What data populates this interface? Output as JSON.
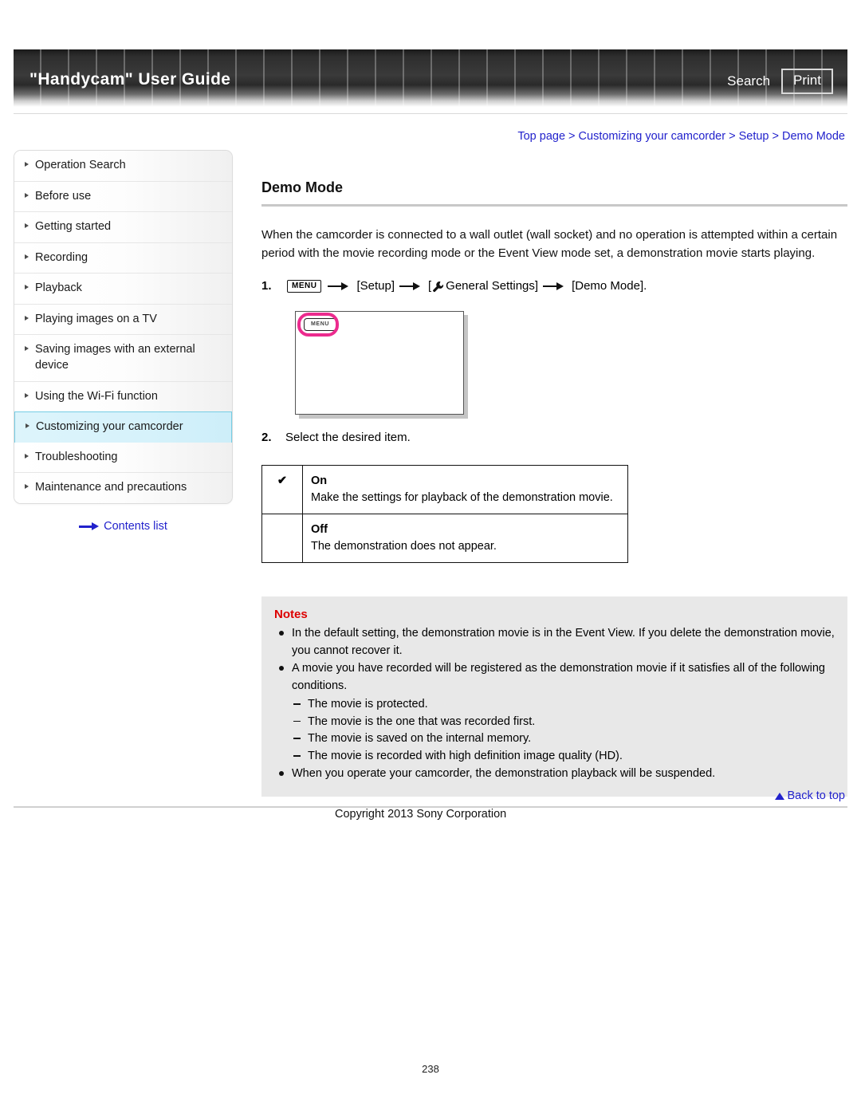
{
  "header": {
    "title": "\"Handycam\" User Guide",
    "search_label": "Search",
    "print_label": "Print"
  },
  "breadcrumb": {
    "text": "Top page > Customizing your camcorder > Setup > Demo Mode"
  },
  "sidebar": {
    "items": [
      {
        "label": "Operation Search",
        "active": false
      },
      {
        "label": "Before use",
        "active": false
      },
      {
        "label": "Getting started",
        "active": false
      },
      {
        "label": "Recording",
        "active": false
      },
      {
        "label": "Playback",
        "active": false
      },
      {
        "label": "Playing images on a TV",
        "active": false
      },
      {
        "label": "Saving images with an external device",
        "active": false
      },
      {
        "label": "Using the Wi-Fi function",
        "active": false
      },
      {
        "label": "Customizing your camcorder",
        "active": true
      },
      {
        "label": "Troubleshooting",
        "active": false
      },
      {
        "label": "Maintenance and precautions",
        "active": false
      }
    ],
    "contents_link": "Contents list",
    "active_bg": "#d6f2fb",
    "active_border": "#76cde4"
  },
  "main": {
    "title": "Demo Mode",
    "intro": "When the camcorder is connected to a wall outlet (wall socket) and no operation is attempted within a certain period with the movie recording mode or the Event View mode set, a demonstration movie starts playing.",
    "step1": {
      "number": "1.",
      "menu_chip": "MENU",
      "part1": "[Setup]",
      "part2": "General Settings]",
      "part2_prefix": "[",
      "part3": "[Demo Mode]."
    },
    "step2": {
      "number": "2.",
      "text": "Select the desired item."
    },
    "illustration": {
      "menu_button_label": "MENU",
      "highlight_color": "#ec2b8e"
    },
    "options_table": {
      "rows": [
        {
          "check": "✔",
          "label": "On",
          "description": "Make the settings for playback of the demonstration movie."
        },
        {
          "check": "",
          "label": "Off",
          "description": "The demonstration does not appear."
        }
      ]
    },
    "notes": {
      "title": "Notes",
      "title_color": "#dd0000",
      "items": [
        "In the default setting, the demonstration movie is in the Event View. If you delete the demonstration movie, you cannot recover it.",
        "A movie you have recorded will be registered as the demonstration movie if it satisfies all of the following conditions.",
        "When you operate your camcorder, the demonstration playback will be suspended."
      ],
      "sub_items": [
        "The movie is protected.",
        "The movie is the one that was recorded first.",
        "The movie is saved on the internal memory.",
        "The movie is recorded with high definition image quality (HD)."
      ]
    }
  },
  "footer": {
    "back_to_top": "Back to top",
    "copyright": "Copyright 2013 Sony Corporation",
    "page_number": "238"
  }
}
